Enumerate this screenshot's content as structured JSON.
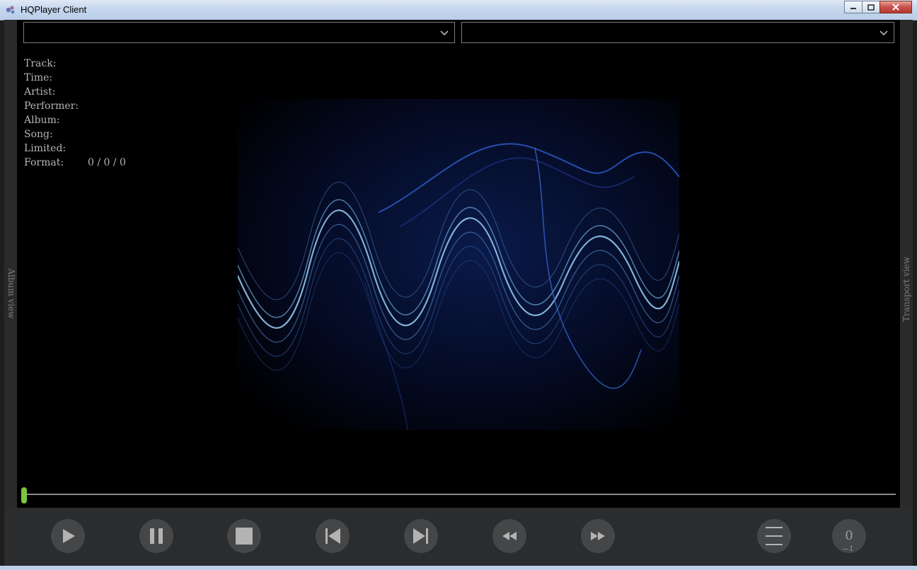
{
  "window": {
    "title": "HQPlayer Client"
  },
  "dropdowns": [
    {
      "value": ""
    },
    {
      "value": ""
    }
  ],
  "info": {
    "track_label": "Track:",
    "time_label": "Time:",
    "artist_label": "Artist:",
    "performer_label": "Performer:",
    "album_label": "Album:",
    "song_label": "Song:",
    "limited_label": "Limited:",
    "format_label": "Format:",
    "format_value": "0 / 0 / 0"
  },
  "side_labels": {
    "left": "Album view",
    "right": "Transport view"
  },
  "seek": {
    "position_fraction": 0.0,
    "handle_color": "#7dc640"
  },
  "controls": [
    {
      "name": "play-button",
      "icon": "play-icon"
    },
    {
      "name": "pause-button",
      "icon": "pause-icon"
    },
    {
      "name": "stop-button",
      "icon": "stop-icon"
    },
    {
      "name": "previous-button",
      "icon": "skip-previous-icon"
    },
    {
      "name": "next-button",
      "icon": "skip-next-icon"
    },
    {
      "name": "rewind-button",
      "icon": "rewind-icon"
    },
    {
      "name": "fast-forward-button",
      "icon": "fast-forward-icon"
    },
    {
      "name": "menu-button",
      "icon": "hamburger-menu-icon"
    }
  ],
  "volume": {
    "value": "0",
    "sub": "—1"
  }
}
